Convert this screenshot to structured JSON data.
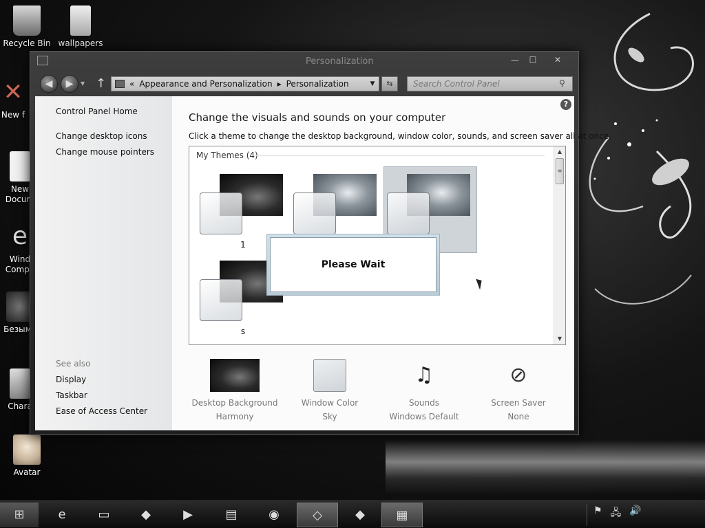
{
  "desktop": {
    "icons": [
      {
        "label_1": "Recycle Bin",
        "label_2": ""
      },
      {
        "label_1": "wallpapers",
        "label_2": ""
      },
      {
        "label_1": "New f",
        "label_2": ""
      },
      {
        "label_1": "New",
        "label_2": "Docum"
      },
      {
        "label_1": "Wind",
        "label_2": "Compa"
      },
      {
        "label_1": "Безымя",
        "label_2": ""
      },
      {
        "label_1": "Chara",
        "label_2": ""
      },
      {
        "label_1": "Avatar",
        "label_2": ""
      }
    ]
  },
  "window": {
    "title": "Personalization",
    "controls": {
      "minimize": "—",
      "maximize": "☐",
      "close": "✕"
    },
    "address": {
      "prefix_icon": "control-panel-icon",
      "separator_left": "«",
      "crumb_1": "Appearance and Personalization",
      "arrow": "▸",
      "crumb_2": "Personalization"
    },
    "search_placeholder": "Search Control Panel"
  },
  "sidebar": {
    "home": "Control Panel Home",
    "links": [
      "Change desktop icons",
      "Change mouse pointers"
    ],
    "see_also_title": "See also",
    "see_also": [
      "Display",
      "Taskbar",
      "Ease of Access Center"
    ]
  },
  "main": {
    "title": "Change the visuals and sounds on your computer",
    "description": "Click a theme to change the desktop background, window color, sounds, and screen saver all at once.",
    "group_header": "My Themes (4)",
    "themes": [
      {
        "label": "1"
      },
      {
        "label": ""
      },
      {
        "label": ""
      },
      {
        "label": "s"
      }
    ],
    "dialog_text": "Please Wait",
    "bottom": [
      {
        "title": "Desktop Background",
        "value": "Harmony"
      },
      {
        "title": "Window Color",
        "value": "Sky"
      },
      {
        "title": "Sounds",
        "value": "Windows Default"
      },
      {
        "title": "Screen Saver",
        "value": "None"
      }
    ]
  },
  "taskbar": {
    "start": "⊞",
    "buttons": [
      "e",
      "▭",
      "◆",
      "▶",
      "▤",
      "◉",
      "◇",
      "◆",
      "▦"
    ],
    "tray": [
      "⚑",
      "🖧",
      "🔊"
    ]
  },
  "colors": {
    "desktop": "#151515",
    "window_frame": "#2e2e2e",
    "selected_tile": "#cfd4d8"
  }
}
